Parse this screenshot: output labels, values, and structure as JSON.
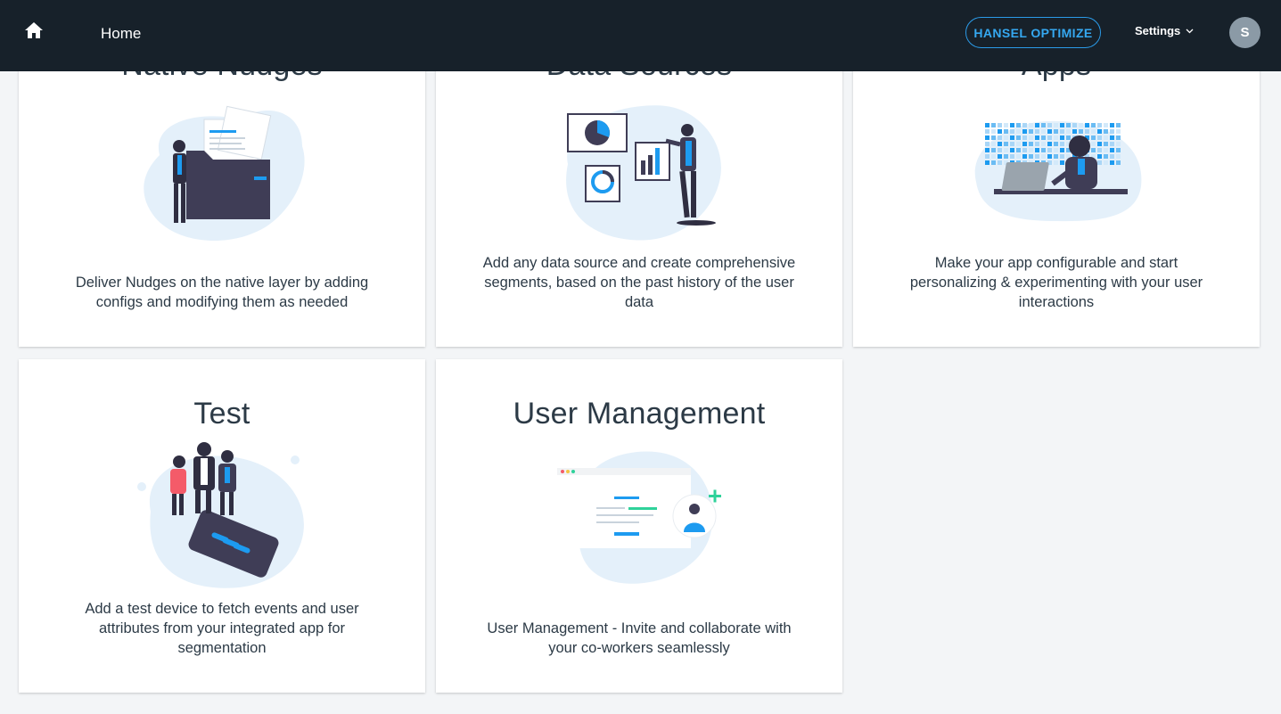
{
  "topbar": {
    "home_label": "Home",
    "optimize_label": "HANSEL OPTIMIZE",
    "settings_label": "Settings",
    "avatar_initial": "S"
  },
  "cards": [
    {
      "title": "Native Nudges",
      "description": "Deliver Nudges on the native layer by adding configs and modifying them as needed"
    },
    {
      "title": "Data Sources",
      "description": "Add any data source and create comprehensive segments, based on the past history of the user data"
    },
    {
      "title": "Apps",
      "description": "Make your app configurable and start personalizing & experimenting with your user interactions"
    },
    {
      "title": "Test",
      "description": "Add a test device to fetch events and user attributes from your integrated app for segmentation"
    },
    {
      "title": "User Management",
      "description": "User Management - Invite and collaborate with your co-workers seamlessly"
    }
  ],
  "colors": {
    "topbar_bg": "#17212a",
    "accent": "#2b9be8",
    "page_bg": "#f3f5f7",
    "blob": "#e4f0fa",
    "illus_dark": "#3f3d56",
    "illus_blue": "#1d9bf0",
    "illus_green": "#2fd29a"
  }
}
